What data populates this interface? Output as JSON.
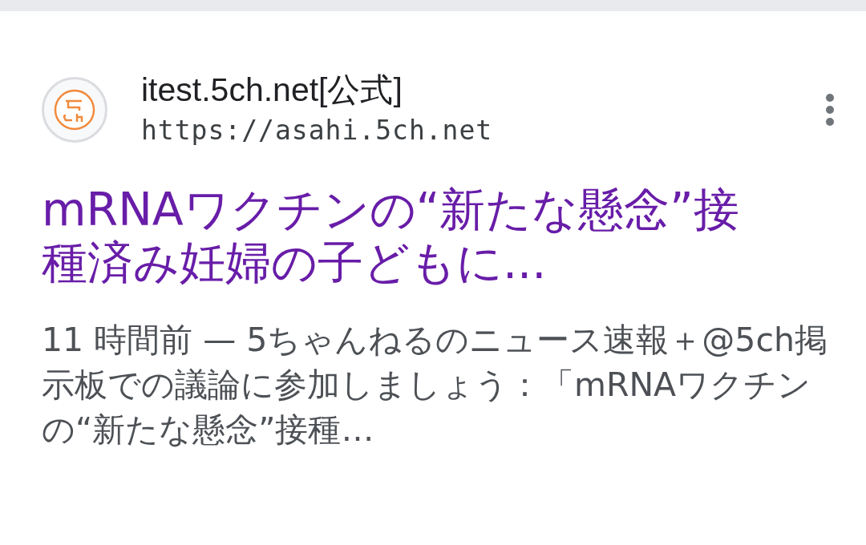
{
  "result": {
    "site_name": "itest.5ch.net[公式]",
    "url": "https://asahi.5ch.net",
    "title": "mRNAワクチンの“新たな懸念”接種済み妊婦の子どもに...",
    "snippet": "11 時間前 — 5ちゃんねるのニュース速報＋@5ch掲示板での議論に参加しましょう：「mRNAワクチンの“新たな懸念”接種…"
  }
}
